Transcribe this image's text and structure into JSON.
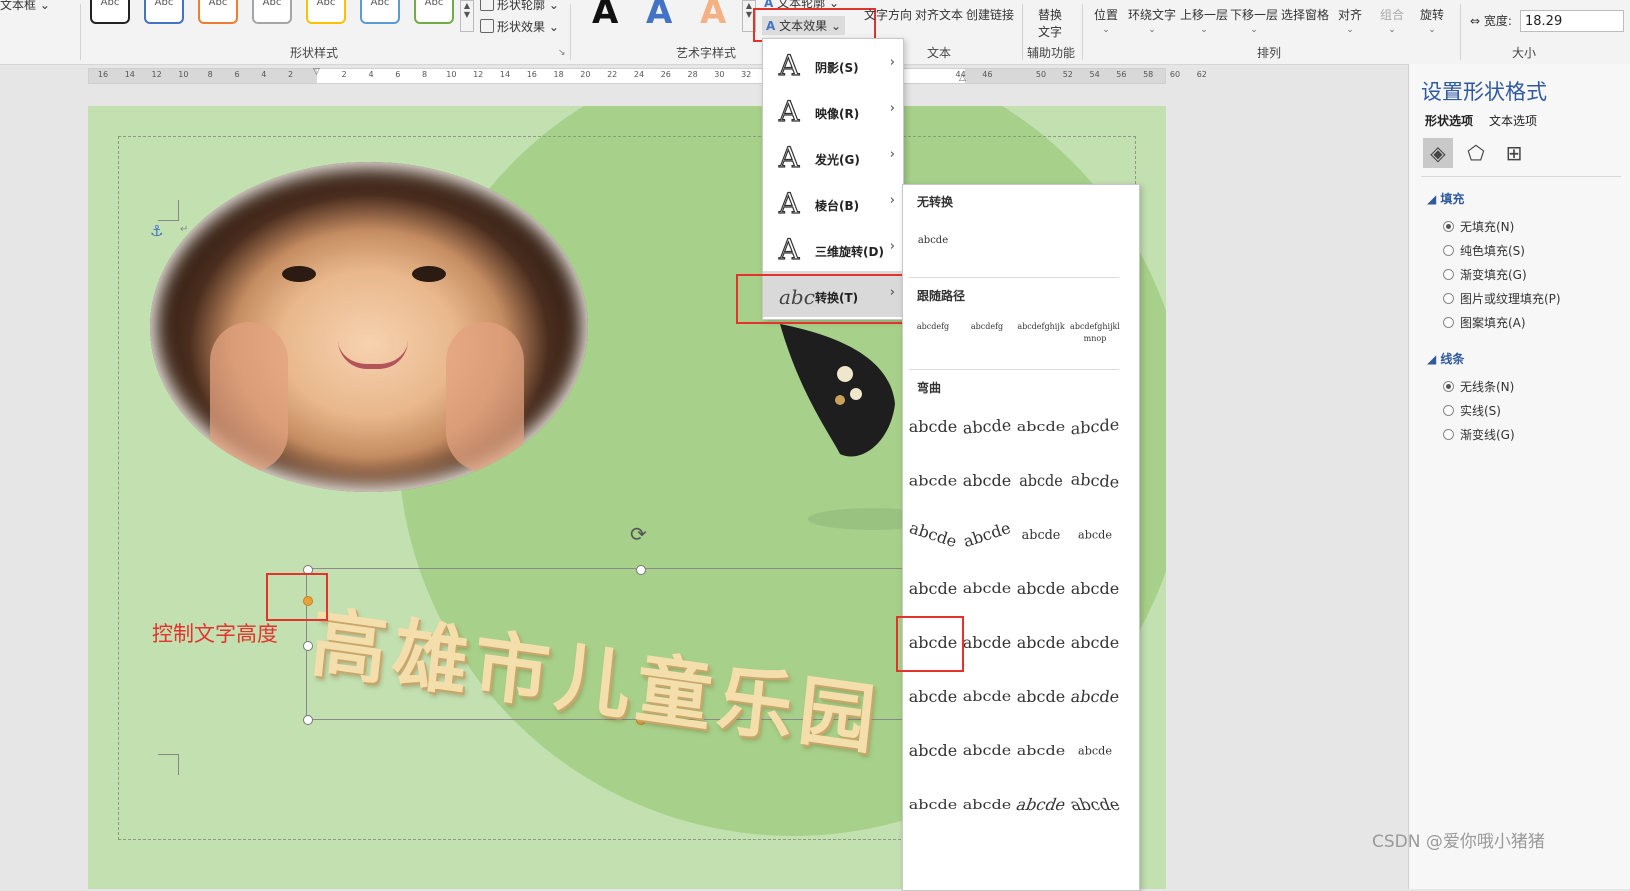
{
  "ribbon": {
    "textbox_label": "文本框",
    "style_swatches": [
      "Abc",
      "Abc",
      "Abc",
      "Abc",
      "Abc",
      "Abc",
      "Abc"
    ],
    "shape_outline": "形状轮廓",
    "shape_effects": "形状效果",
    "shape_styles_group": "形状样式",
    "text_outline": "文本轮廓",
    "text_effects": "文本效果",
    "wordart_group": "艺术字样式",
    "text_direction": "文字方向",
    "align_text": "对齐文本",
    "create_link": "创建链接",
    "text_group": "文本",
    "alt_text_line1": "替换",
    "alt_text_line2": "文字",
    "accessibility_group": "辅助功能",
    "position": "位置",
    "wrap_text": "环绕文字",
    "bring_forward": "上移一层",
    "send_backward": "下移一层",
    "selection_pane": "选择窗格",
    "align": "对齐",
    "group": "组合",
    "rotate": "旋转",
    "arrange_group": "排列",
    "width_label": "宽度:",
    "width_value": "18.29",
    "size_group": "大小"
  },
  "ruler": {
    "ticks": [
      "16",
      "14",
      "12",
      "10",
      "8",
      "6",
      "4",
      "2",
      "",
      "2",
      "4",
      "6",
      "8",
      "10",
      "12",
      "14",
      "16",
      "18",
      "20",
      "22",
      "24",
      "26",
      "28",
      "30",
      "32",
      "",
      "",
      "",
      "",
      "",
      "",
      "",
      "44",
      "46",
      "",
      "50",
      "52",
      "54",
      "56",
      "58",
      "60",
      "62"
    ]
  },
  "text_effects_menu": {
    "items": [
      {
        "label": "阴影(S)",
        "glyph": "A"
      },
      {
        "label": "映像(R)",
        "glyph": "A"
      },
      {
        "label": "发光(G)",
        "glyph": "A"
      },
      {
        "label": "棱台(B)",
        "glyph": "A"
      },
      {
        "label": "三维旋转(D)",
        "glyph": "A"
      },
      {
        "label": "转换(T)",
        "glyph": "abc"
      }
    ]
  },
  "transform_gallery": {
    "no_transform_heading": "无转换",
    "no_transform_sample": "abcde",
    "follow_path_heading": "跟随路径",
    "follow_path_samples": [
      "abcdefg",
      "abcdefg",
      "abcdefghijk",
      "abcdefghijklmnop"
    ],
    "warp_heading": "弯曲",
    "warp_samples": [
      "abcde",
      "abcde",
      "abcde",
      "abcde",
      "abcde",
      "abcde",
      "abcde",
      "abcde",
      "abcde",
      "abcde",
      "abcde",
      "abcde",
      "abcde",
      "abcde",
      "abcde",
      "abcde",
      "abcde",
      "abcde",
      "abcde",
      "abcde",
      "abcde",
      "abcde",
      "abcde",
      "abcde",
      "abcde",
      "abcde",
      "abcde",
      "abcde",
      "abcde",
      "abcde",
      "abcde",
      "abcde"
    ]
  },
  "slide": {
    "wordart_text": "高雄市儿童乐园",
    "annotation": "控制文字高度"
  },
  "pane": {
    "title": "设置形状格式",
    "tab_shape": "形状选项",
    "tab_text": "文本选项",
    "fill_heading": "填充",
    "fill_options": [
      "无填充(N)",
      "纯色填充(S)",
      "渐变填充(G)",
      "图片或纹理填充(P)",
      "图案填充(A)"
    ],
    "fill_selected": 0,
    "line_heading": "线条",
    "line_options": [
      "无线条(N)",
      "实线(S)",
      "渐变线(G)"
    ],
    "line_selected": 0
  },
  "watermark": "CSDN @爱你哦小猪猪",
  "colors": {
    "accent": "#2f5aa0",
    "annotation_red": "#e5322d",
    "slide_bg": "#c3e0b1",
    "slide_circle": "#a7d18a",
    "wordart_fill": "#f4deab"
  }
}
